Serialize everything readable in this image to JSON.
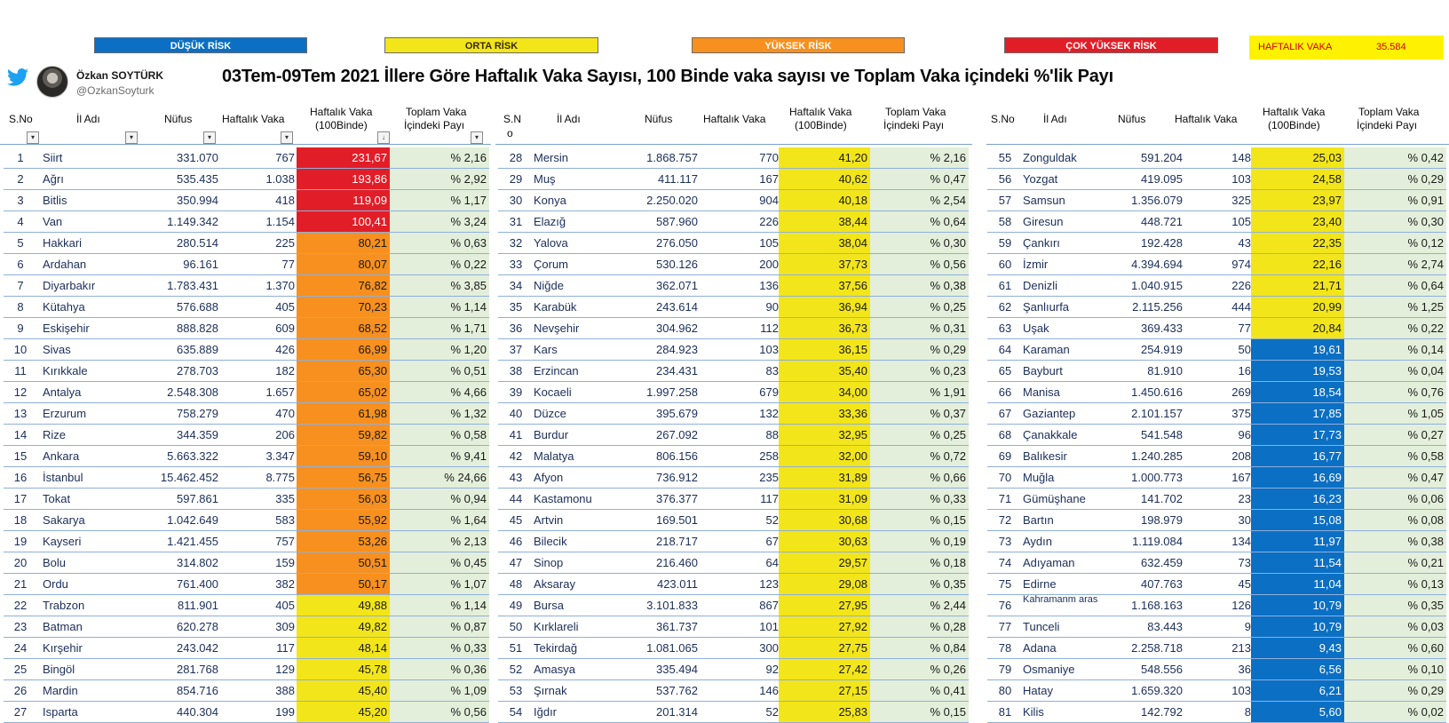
{
  "legend": {
    "low": "DÜŞÜK RİSK",
    "medium": "ORTA RİSK",
    "high": "YÜKSEK RİSK",
    "very_high": "ÇOK YÜKSEK RİSK",
    "weekly_label": "HAFTALIK VAKA",
    "weekly_value": "35.584"
  },
  "colors": {
    "very_high": "#e11e28",
    "high": "#f7901e",
    "medium": "#f2e51a",
    "low": "#0b6fc4",
    "share_bg": "#e3efda"
  },
  "author": {
    "name": "Özkan SOYTÜRK",
    "handle": "@OzkanSoyturk",
    "icon": "twitter-icon"
  },
  "title": "03Tem-09Tem 2021  İllere Göre Haftalık Vaka Sayısı, 100 Binde vaka sayısı ve Toplam Vaka içindeki %'lik Payı",
  "headers": [
    {
      "sno": "S.No",
      "il": "İl Adı",
      "nufus": "Nüfus",
      "vaka": "Haftalık Vaka",
      "rate1": "Haftalık Vaka",
      "rate2": "(100Binde)",
      "share1": "Toplam Vaka",
      "share2": "İçindeki Payı"
    },
    {
      "sno": "S.N",
      "sno2": "o",
      "il": "İl Adı",
      "nufus": "Nüfus",
      "vaka": "Haftalık Vaka",
      "rate1": "Haftalık Vaka",
      "rate2": "(100Binde)",
      "share1": "Toplam Vaka",
      "share2": "İçindeki Payı"
    },
    {
      "sno": "S.No",
      "il": "İl Adı",
      "nufus": "Nüfus",
      "vaka": "Haftalık Vaka",
      "rate1": "Haftalık Vaka",
      "rate2": "(100Binde)",
      "share1": "Toplam Vaka",
      "share2": "İçindeki Payı"
    }
  ],
  "blocks": [
    [
      {
        "no": "1",
        "il": "Siirt",
        "nufus": "331.070",
        "vaka": "767",
        "rate": "231,67",
        "risk": "red",
        "share": "% 2,16"
      },
      {
        "no": "2",
        "il": "Ağrı",
        "nufus": "535.435",
        "vaka": "1.038",
        "rate": "193,86",
        "risk": "red",
        "share": "% 2,92"
      },
      {
        "no": "3",
        "il": "Bitlis",
        "nufus": "350.994",
        "vaka": "418",
        "rate": "119,09",
        "risk": "red",
        "share": "% 1,17"
      },
      {
        "no": "4",
        "il": "Van",
        "nufus": "1.149.342",
        "vaka": "1.154",
        "rate": "100,41",
        "risk": "red",
        "share": "% 3,24"
      },
      {
        "no": "5",
        "il": "Hakkari",
        "nufus": "280.514",
        "vaka": "225",
        "rate": "80,21",
        "risk": "orange",
        "share": "% 0,63"
      },
      {
        "no": "6",
        "il": "Ardahan",
        "nufus": "96.161",
        "vaka": "77",
        "rate": "80,07",
        "risk": "orange",
        "share": "% 0,22"
      },
      {
        "no": "7",
        "il": "Diyarbakır",
        "nufus": "1.783.431",
        "vaka": "1.370",
        "rate": "76,82",
        "risk": "orange",
        "share": "% 3,85"
      },
      {
        "no": "8",
        "il": "Kütahya",
        "nufus": "576.688",
        "vaka": "405",
        "rate": "70,23",
        "risk": "orange",
        "share": "% 1,14"
      },
      {
        "no": "9",
        "il": "Eskişehir",
        "nufus": "888.828",
        "vaka": "609",
        "rate": "68,52",
        "risk": "orange",
        "share": "% 1,71"
      },
      {
        "no": "10",
        "il": "Sivas",
        "nufus": "635.889",
        "vaka": "426",
        "rate": "66,99",
        "risk": "orange",
        "share": "% 1,20"
      },
      {
        "no": "11",
        "il": "Kırıkkale",
        "nufus": "278.703",
        "vaka": "182",
        "rate": "65,30",
        "risk": "orange",
        "share": "% 0,51"
      },
      {
        "no": "12",
        "il": "Antalya",
        "nufus": "2.548.308",
        "vaka": "1.657",
        "rate": "65,02",
        "risk": "orange",
        "share": "% 4,66"
      },
      {
        "no": "13",
        "il": "Erzurum",
        "nufus": "758.279",
        "vaka": "470",
        "rate": "61,98",
        "risk": "orange",
        "share": "% 1,32"
      },
      {
        "no": "14",
        "il": "Rize",
        "nufus": "344.359",
        "vaka": "206",
        "rate": "59,82",
        "risk": "orange",
        "share": "% 0,58"
      },
      {
        "no": "15",
        "il": "Ankara",
        "nufus": "5.663.322",
        "vaka": "3.347",
        "rate": "59,10",
        "risk": "orange",
        "share": "% 9,41"
      },
      {
        "no": "16",
        "il": "İstanbul",
        "nufus": "15.462.452",
        "vaka": "8.775",
        "rate": "56,75",
        "risk": "orange",
        "share": "% 24,66"
      },
      {
        "no": "17",
        "il": "Tokat",
        "nufus": "597.861",
        "vaka": "335",
        "rate": "56,03",
        "risk": "orange",
        "share": "% 0,94"
      },
      {
        "no": "18",
        "il": "Sakarya",
        "nufus": "1.042.649",
        "vaka": "583",
        "rate": "55,92",
        "risk": "orange",
        "share": "% 1,64"
      },
      {
        "no": "19",
        "il": "Kayseri",
        "nufus": "1.421.455",
        "vaka": "757",
        "rate": "53,26",
        "risk": "orange",
        "share": "% 2,13"
      },
      {
        "no": "20",
        "il": "Bolu",
        "nufus": "314.802",
        "vaka": "159",
        "rate": "50,51",
        "risk": "orange",
        "share": "% 0,45"
      },
      {
        "no": "21",
        "il": "Ordu",
        "nufus": "761.400",
        "vaka": "382",
        "rate": "50,17",
        "risk": "orange",
        "share": "% 1,07"
      },
      {
        "no": "22",
        "il": "Trabzon",
        "nufus": "811.901",
        "vaka": "405",
        "rate": "49,88",
        "risk": "yellow",
        "share": "% 1,14"
      },
      {
        "no": "23",
        "il": "Batman",
        "nufus": "620.278",
        "vaka": "309",
        "rate": "49,82",
        "risk": "yellow",
        "share": "% 0,87"
      },
      {
        "no": "24",
        "il": "Kırşehir",
        "nufus": "243.042",
        "vaka": "117",
        "rate": "48,14",
        "risk": "yellow",
        "share": "% 0,33"
      },
      {
        "no": "25",
        "il": "Bingöl",
        "nufus": "281.768",
        "vaka": "129",
        "rate": "45,78",
        "risk": "yellow",
        "share": "% 0,36"
      },
      {
        "no": "26",
        "il": "Mardin",
        "nufus": "854.716",
        "vaka": "388",
        "rate": "45,40",
        "risk": "yellow",
        "share": "% 1,09"
      },
      {
        "no": "27",
        "il": "Isparta",
        "nufus": "440.304",
        "vaka": "199",
        "rate": "45,20",
        "risk": "yellow",
        "share": "% 0,56"
      }
    ],
    [
      {
        "no": "28",
        "il": "Mersin",
        "nufus": "1.868.757",
        "vaka": "770",
        "rate": "41,20",
        "risk": "yellow",
        "share": "% 2,16"
      },
      {
        "no": "29",
        "il": "Muş",
        "nufus": "411.117",
        "vaka": "167",
        "rate": "40,62",
        "risk": "yellow",
        "share": "% 0,47"
      },
      {
        "no": "30",
        "il": "Konya",
        "nufus": "2.250.020",
        "vaka": "904",
        "rate": "40,18",
        "risk": "yellow",
        "share": "% 2,54"
      },
      {
        "no": "31",
        "il": "Elazığ",
        "nufus": "587.960",
        "vaka": "226",
        "rate": "38,44",
        "risk": "yellow",
        "share": "% 0,64"
      },
      {
        "no": "32",
        "il": "Yalova",
        "nufus": "276.050",
        "vaka": "105",
        "rate": "38,04",
        "risk": "yellow",
        "share": "% 0,30"
      },
      {
        "no": "33",
        "il": "Çorum",
        "nufus": "530.126",
        "vaka": "200",
        "rate": "37,73",
        "risk": "yellow",
        "share": "% 0,56"
      },
      {
        "no": "34",
        "il": "Niğde",
        "nufus": "362.071",
        "vaka": "136",
        "rate": "37,56",
        "risk": "yellow",
        "share": "% 0,38"
      },
      {
        "no": "35",
        "il": "Karabük",
        "nufus": "243.614",
        "vaka": "90",
        "rate": "36,94",
        "risk": "yellow",
        "share": "% 0,25"
      },
      {
        "no": "36",
        "il": "Nevşehir",
        "nufus": "304.962",
        "vaka": "112",
        "rate": "36,73",
        "risk": "yellow",
        "share": "% 0,31"
      },
      {
        "no": "37",
        "il": "Kars",
        "nufus": "284.923",
        "vaka": "103",
        "rate": "36,15",
        "risk": "yellow",
        "share": "% 0,29"
      },
      {
        "no": "38",
        "il": "Erzincan",
        "nufus": "234.431",
        "vaka": "83",
        "rate": "35,40",
        "risk": "yellow",
        "share": "% 0,23"
      },
      {
        "no": "39",
        "il": "Kocaeli",
        "nufus": "1.997.258",
        "vaka": "679",
        "rate": "34,00",
        "risk": "yellow",
        "share": "% 1,91"
      },
      {
        "no": "40",
        "il": "Düzce",
        "nufus": "395.679",
        "vaka": "132",
        "rate": "33,36",
        "risk": "yellow",
        "share": "% 0,37"
      },
      {
        "no": "41",
        "il": "Burdur",
        "nufus": "267.092",
        "vaka": "88",
        "rate": "32,95",
        "risk": "yellow",
        "share": "% 0,25"
      },
      {
        "no": "42",
        "il": "Malatya",
        "nufus": "806.156",
        "vaka": "258",
        "rate": "32,00",
        "risk": "yellow",
        "share": "% 0,72"
      },
      {
        "no": "43",
        "il": "Afyon",
        "nufus": "736.912",
        "vaka": "235",
        "rate": "31,89",
        "risk": "yellow",
        "share": "% 0,66"
      },
      {
        "no": "44",
        "il": "Kastamonu",
        "nufus": "376.377",
        "vaka": "117",
        "rate": "31,09",
        "risk": "yellow",
        "share": "% 0,33"
      },
      {
        "no": "45",
        "il": "Artvin",
        "nufus": "169.501",
        "vaka": "52",
        "rate": "30,68",
        "risk": "yellow",
        "share": "% 0,15"
      },
      {
        "no": "46",
        "il": "Bilecik",
        "nufus": "218.717",
        "vaka": "67",
        "rate": "30,63",
        "risk": "yellow",
        "share": "% 0,19"
      },
      {
        "no": "47",
        "il": "Sinop",
        "nufus": "216.460",
        "vaka": "64",
        "rate": "29,57",
        "risk": "yellow",
        "share": "% 0,18"
      },
      {
        "no": "48",
        "il": "Aksaray",
        "nufus": "423.011",
        "vaka": "123",
        "rate": "29,08",
        "risk": "yellow",
        "share": "% 0,35"
      },
      {
        "no": "49",
        "il": "Bursa",
        "nufus": "3.101.833",
        "vaka": "867",
        "rate": "27,95",
        "risk": "yellow",
        "share": "% 2,44"
      },
      {
        "no": "50",
        "il": "Kırklareli",
        "nufus": "361.737",
        "vaka": "101",
        "rate": "27,92",
        "risk": "yellow",
        "share": "% 0,28"
      },
      {
        "no": "51",
        "il": "Tekirdağ",
        "nufus": "1.081.065",
        "vaka": "300",
        "rate": "27,75",
        "risk": "yellow",
        "share": "% 0,84"
      },
      {
        "no": "52",
        "il": "Amasya",
        "nufus": "335.494",
        "vaka": "92",
        "rate": "27,42",
        "risk": "yellow",
        "share": "% 0,26"
      },
      {
        "no": "53",
        "il": "Şırnak",
        "nufus": "537.762",
        "vaka": "146",
        "rate": "27,15",
        "risk": "yellow",
        "share": "% 0,41"
      },
      {
        "no": "54",
        "il": "Iğdır",
        "nufus": "201.314",
        "vaka": "52",
        "rate": "25,83",
        "risk": "yellow",
        "share": "% 0,15"
      }
    ],
    [
      {
        "no": "55",
        "il": "Zonguldak",
        "nufus": "591.204",
        "vaka": "148",
        "rate": "25,03",
        "risk": "yellow",
        "share": "% 0,42"
      },
      {
        "no": "56",
        "il": "Yozgat",
        "nufus": "419.095",
        "vaka": "103",
        "rate": "24,58",
        "risk": "yellow",
        "share": "% 0,29"
      },
      {
        "no": "57",
        "il": "Samsun",
        "nufus": "1.356.079",
        "vaka": "325",
        "rate": "23,97",
        "risk": "yellow",
        "share": "% 0,91"
      },
      {
        "no": "58",
        "il": "Giresun",
        "nufus": "448.721",
        "vaka": "105",
        "rate": "23,40",
        "risk": "yellow",
        "share": "% 0,30"
      },
      {
        "no": "59",
        "il": "Çankırı",
        "nufus": "192.428",
        "vaka": "43",
        "rate": "22,35",
        "risk": "yellow",
        "share": "% 0,12"
      },
      {
        "no": "60",
        "il": "İzmir",
        "nufus": "4.394.694",
        "vaka": "974",
        "rate": "22,16",
        "risk": "yellow",
        "share": "% 2,74"
      },
      {
        "no": "61",
        "il": "Denizli",
        "nufus": "1.040.915",
        "vaka": "226",
        "rate": "21,71",
        "risk": "yellow",
        "share": "% 0,64"
      },
      {
        "no": "62",
        "il": "Şanlıurfa",
        "nufus": "2.115.256",
        "vaka": "444",
        "rate": "20,99",
        "risk": "yellow",
        "share": "% 1,25"
      },
      {
        "no": "63",
        "il": "Uşak",
        "nufus": "369.433",
        "vaka": "77",
        "rate": "20,84",
        "risk": "yellow",
        "share": "% 0,22"
      },
      {
        "no": "64",
        "il": "Karaman",
        "nufus": "254.919",
        "vaka": "50",
        "rate": "19,61",
        "risk": "blue",
        "share": "% 0,14"
      },
      {
        "no": "65",
        "il": "Bayburt",
        "nufus": "81.910",
        "vaka": "16",
        "rate": "19,53",
        "risk": "blue",
        "share": "% 0,04"
      },
      {
        "no": "66",
        "il": "Manisa",
        "nufus": "1.450.616",
        "vaka": "269",
        "rate": "18,54",
        "risk": "blue",
        "share": "% 0,76"
      },
      {
        "no": "67",
        "il": "Gaziantep",
        "nufus": "2.101.157",
        "vaka": "375",
        "rate": "17,85",
        "risk": "blue",
        "share": "% 1,05"
      },
      {
        "no": "68",
        "il": "Çanakkale",
        "nufus": "541.548",
        "vaka": "96",
        "rate": "17,73",
        "risk": "blue",
        "share": "% 0,27"
      },
      {
        "no": "69",
        "il": "Balıkesir",
        "nufus": "1.240.285",
        "vaka": "208",
        "rate": "16,77",
        "risk": "blue",
        "share": "% 0,58"
      },
      {
        "no": "70",
        "il": "Muğla",
        "nufus": "1.000.773",
        "vaka": "167",
        "rate": "16,69",
        "risk": "blue",
        "share": "% 0,47"
      },
      {
        "no": "71",
        "il": "Gümüşhane",
        "nufus": "141.702",
        "vaka": "23",
        "rate": "16,23",
        "risk": "blue",
        "share": "% 0,06"
      },
      {
        "no": "72",
        "il": "Bartın",
        "nufus": "198.979",
        "vaka": "30",
        "rate": "15,08",
        "risk": "blue",
        "share": "% 0,08"
      },
      {
        "no": "73",
        "il": "Aydın",
        "nufus": "1.119.084",
        "vaka": "134",
        "rate": "11,97",
        "risk": "blue",
        "share": "% 0,38"
      },
      {
        "no": "74",
        "il": "Adıyaman",
        "nufus": "632.459",
        "vaka": "73",
        "rate": "11,54",
        "risk": "blue",
        "share": "% 0,21"
      },
      {
        "no": "75",
        "il": "Edirne",
        "nufus": "407.763",
        "vaka": "45",
        "rate": "11,04",
        "risk": "blue",
        "share": "% 0,13"
      },
      {
        "no": "76",
        "il": "Kahramanm aras",
        "nufus": "1.168.163",
        "vaka": "126",
        "rate": "10,79",
        "risk": "blue",
        "share": "% 0,35",
        "small": true
      },
      {
        "no": "77",
        "il": "Tunceli",
        "nufus": "83.443",
        "vaka": "9",
        "rate": "10,79",
        "risk": "blue",
        "share": "% 0,03"
      },
      {
        "no": "78",
        "il": "Adana",
        "nufus": "2.258.718",
        "vaka": "213",
        "rate": "9,43",
        "risk": "blue",
        "share": "% 0,60"
      },
      {
        "no": "79",
        "il": "Osmaniye",
        "nufus": "548.556",
        "vaka": "36",
        "rate": "6,56",
        "risk": "blue",
        "share": "% 0,10"
      },
      {
        "no": "80",
        "il": "Hatay",
        "nufus": "1.659.320",
        "vaka": "103",
        "rate": "6,21",
        "risk": "blue",
        "share": "% 0,29"
      },
      {
        "no": "81",
        "il": "Kilis",
        "nufus": "142.792",
        "vaka": "8",
        "rate": "5,60",
        "risk": "blue",
        "share": "% 0,02"
      }
    ]
  ]
}
